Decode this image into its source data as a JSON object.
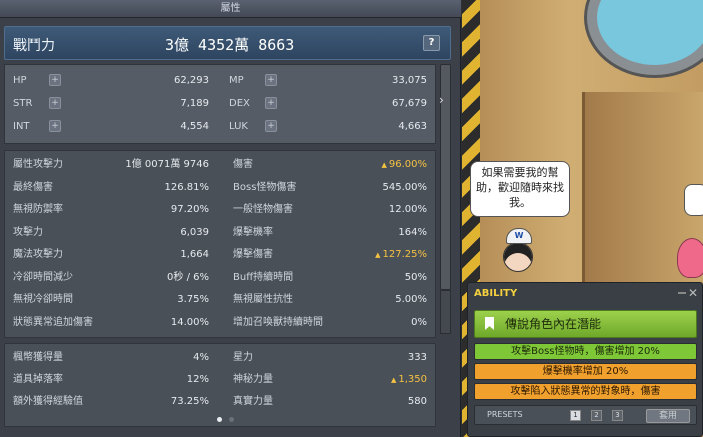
{
  "window": {
    "title": "屬性"
  },
  "combat_power": {
    "label": "戰鬥力",
    "value": "3億 4352萬 8663",
    "help": "?"
  },
  "base_stats": [
    {
      "label": "HP",
      "value": "62,293"
    },
    {
      "label": "MP",
      "value": "33,075"
    },
    {
      "label": "STR",
      "value": "7,189"
    },
    {
      "label": "DEX",
      "value": "67,679"
    },
    {
      "label": "INT",
      "value": "4,554"
    },
    {
      "label": "LUK",
      "value": "4,663"
    }
  ],
  "plus_icon": "+",
  "expand_arrow": "›",
  "detail_left": [
    {
      "label": "屬性攻擊力",
      "value": "1億 0071萬 9746"
    },
    {
      "label": "最終傷害",
      "value": "126.81%"
    },
    {
      "label": "無視防禦率",
      "value": "97.20%"
    },
    {
      "label": "攻擊力",
      "value": "6,039"
    },
    {
      "label": "魔法攻擊力",
      "value": "1,664"
    },
    {
      "label": "冷卻時間減少",
      "value": "0秒 / 6%"
    },
    {
      "label": "無視冷卻時間",
      "value": "3.75%"
    },
    {
      "label": "狀態異常追加傷害",
      "value": "14.00%"
    }
  ],
  "detail_right": [
    {
      "label": "傷害",
      "value": "96.00%",
      "highlight": true
    },
    {
      "label": "Boss怪物傷害",
      "value": "545.00%"
    },
    {
      "label": "一般怪物傷害",
      "value": "12.00%"
    },
    {
      "label": "爆擊機率",
      "value": "164%"
    },
    {
      "label": "爆擊傷害",
      "value": "127.25%",
      "highlight": true
    },
    {
      "label": "Buff持續時間",
      "value": "50%"
    },
    {
      "label": "無視屬性抗性",
      "value": "5.00%"
    },
    {
      "label": "增加召喚獸持續時間",
      "value": "0%"
    }
  ],
  "extra_left": [
    {
      "label": "楓幣獲得量",
      "value": "4%"
    },
    {
      "label": "道具掉落率",
      "value": "12%"
    },
    {
      "label": "額外獲得經驗值",
      "value": "73.25%"
    }
  ],
  "extra_right": [
    {
      "label": "星力",
      "value": "333"
    },
    {
      "label": "神秘力量",
      "value": "1,350",
      "highlight": true
    },
    {
      "label": "真實力量",
      "value": "580"
    }
  ],
  "npc": {
    "speech": "如果需要我的幫助，歡迎隨時來找我。",
    "hat_letter": "W"
  },
  "ability": {
    "title": "ABILITY",
    "close": "✕",
    "header": "傳說角色內在潛能",
    "lines": [
      {
        "text": "攻擊Boss怪物時，傷害增加 20%",
        "tier": "green"
      },
      {
        "text": "爆擊機率增加 20%",
        "tier": "orange"
      },
      {
        "text": "攻擊陷入狀態異常的對象時，傷害",
        "tier": "orange"
      }
    ],
    "presets_label": "PRESETS",
    "presets": [
      "1",
      "2",
      "3"
    ],
    "active_preset": "1",
    "apply": "套用"
  },
  "colors": {
    "highlight": "#f4c242",
    "legendary": "#7ec737",
    "unique": "#f0a02c"
  }
}
